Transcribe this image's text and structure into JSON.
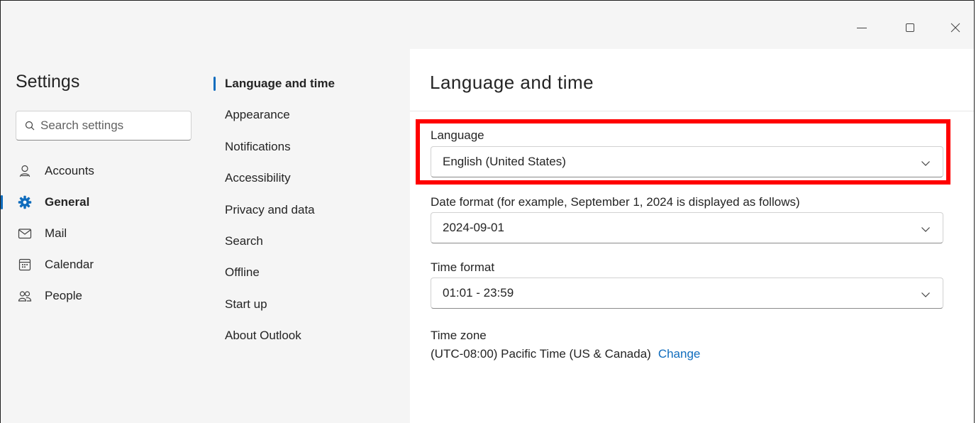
{
  "window": {
    "controls": {
      "minimize": "minimize",
      "maximize": "maximize",
      "close": "close"
    }
  },
  "sidebar": {
    "title": "Settings",
    "search_placeholder": "Search settings",
    "items": [
      {
        "label": "Accounts",
        "icon": "person-icon",
        "active": false
      },
      {
        "label": "General",
        "icon": "gear-icon",
        "active": true
      },
      {
        "label": "Mail",
        "icon": "mail-icon",
        "active": false
      },
      {
        "label": "Calendar",
        "icon": "calendar-icon",
        "active": false
      },
      {
        "label": "People",
        "icon": "people-icon",
        "active": false
      }
    ]
  },
  "subnav": {
    "items": [
      {
        "label": "Language and time",
        "active": true
      },
      {
        "label": "Appearance"
      },
      {
        "label": "Notifications"
      },
      {
        "label": "Accessibility"
      },
      {
        "label": "Privacy and data"
      },
      {
        "label": "Search"
      },
      {
        "label": "Offline"
      },
      {
        "label": "Start up"
      },
      {
        "label": "About Outlook"
      }
    ]
  },
  "content": {
    "title": "Language and time",
    "language": {
      "label": "Language",
      "value": "English (United States)"
    },
    "date_format": {
      "label": "Date format (for example, September 1, 2024 is displayed as follows)",
      "value": "2024-09-01"
    },
    "time_format": {
      "label": "Time format",
      "value": "01:01 - 23:59"
    },
    "time_zone": {
      "label": "Time zone",
      "value": "(UTC-08:00) Pacific Time (US & Canada)",
      "change_label": "Change"
    }
  },
  "colors": {
    "accent": "#0f6cbd",
    "highlight": "#ff0000",
    "nav_bg": "#f5f5f5",
    "content_bg": "#ffffff"
  }
}
